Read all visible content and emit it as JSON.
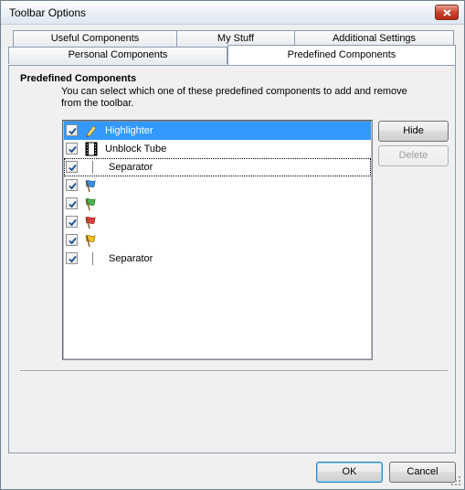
{
  "window": {
    "title": "Toolbar Options"
  },
  "tabs_row1": [
    "Useful Components",
    "My Stuff",
    "Additional Settings"
  ],
  "tabs_row2": [
    "Personal Components",
    "Predefined Components"
  ],
  "section": {
    "title": "Predefined Components",
    "description": "You can select which one of these predefined components to add and remove from the toolbar."
  },
  "list": {
    "items": [
      {
        "label": "Highlighter",
        "checked": true,
        "icon": "highlighter-icon",
        "selected": true
      },
      {
        "label": "Unblock Tube",
        "checked": true,
        "icon": "film-icon"
      },
      {
        "label": "Separator",
        "checked": true,
        "icon": "separator",
        "focused": true
      },
      {
        "label": "",
        "checked": true,
        "icon": "blue-flag-icon",
        "color": "#3b8fe0"
      },
      {
        "label": "",
        "checked": true,
        "icon": "green-flag-icon",
        "color": "#4db34d"
      },
      {
        "label": "",
        "checked": true,
        "icon": "red-flag-icon",
        "color": "#e04040"
      },
      {
        "label": "",
        "checked": true,
        "icon": "yellow-flag-icon",
        "color": "#f0c020"
      },
      {
        "label": "Separator",
        "checked": true,
        "icon": "separator"
      }
    ]
  },
  "side_buttons": {
    "hide": "Hide",
    "delete": "Delete"
  },
  "footer": {
    "ok": "OK",
    "cancel": "Cancel"
  }
}
